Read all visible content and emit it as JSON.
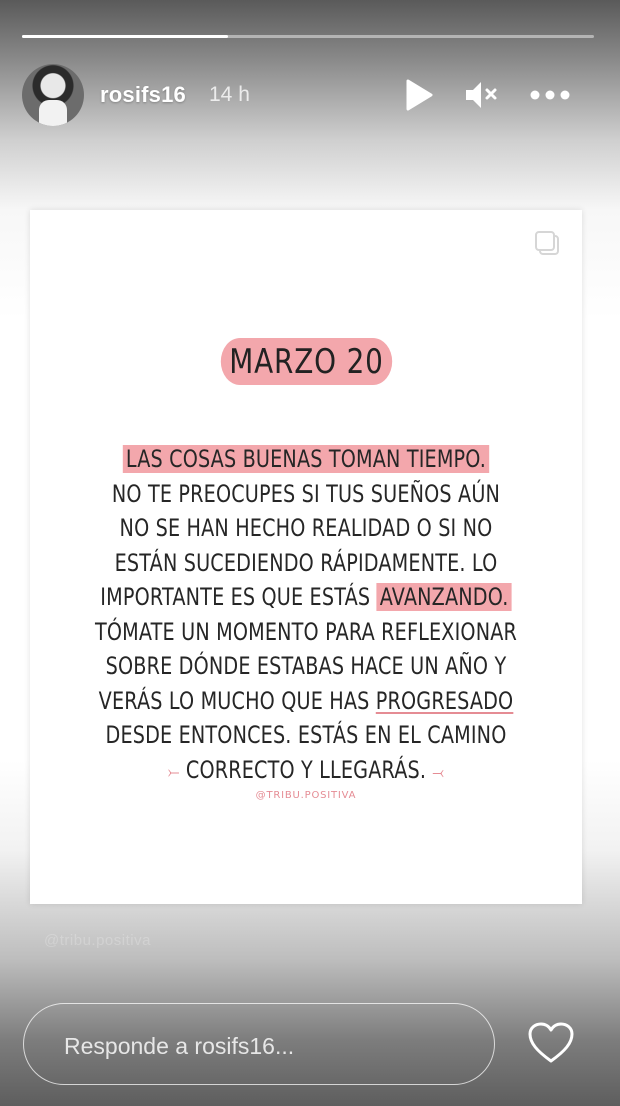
{
  "story": {
    "progress_fraction": 0.36
  },
  "header": {
    "username": "rosifs16",
    "timestamp": "14 h",
    "play_icon": "play-icon",
    "mute_icon": "mute-icon",
    "more_icon": "more-icon"
  },
  "post": {
    "date_label": "MARZO 20",
    "lines": [
      {
        "text": "LAS COSAS BUENAS TOMAN TIEMPO."
      },
      {
        "text": "NO TE PREOCUPES SI TUS SUEÑOS AÚN"
      },
      {
        "text": "NO SE HAN HECHO REALIDAD O SI NO"
      },
      {
        "text": "ESTÁN SUCEDIENDO RÁPIDAMENTE. LO"
      },
      {
        "before": "IMPORTANTE ES QUE ESTÁS ",
        "highlight": "AVANZANDO."
      },
      {
        "text": "TÓMATE UN MOMENTO PARA REFLEXIONAR"
      },
      {
        "text": "SOBRE DÓNDE ESTABAS HACE UN AÑO Y"
      },
      {
        "before": "VERÁS LO MUCHO QUE HAS ",
        "underline": "PROGRESADO"
      },
      {
        "text": "DESDE ENTONCES. ESTÁS EN EL CAMINO"
      },
      {
        "text": "CORRECTO Y LLEGARÁS."
      }
    ],
    "arrow_left": "⤚",
    "arrow_right": "⤙",
    "credit": "@TRIBU.POSITIVA",
    "watermark": "@tribu.positiva",
    "accent_color": "#f3a7ac"
  },
  "footer": {
    "reply_placeholder": "Responde a rosifs16...",
    "heart_icon": "heart-icon"
  }
}
